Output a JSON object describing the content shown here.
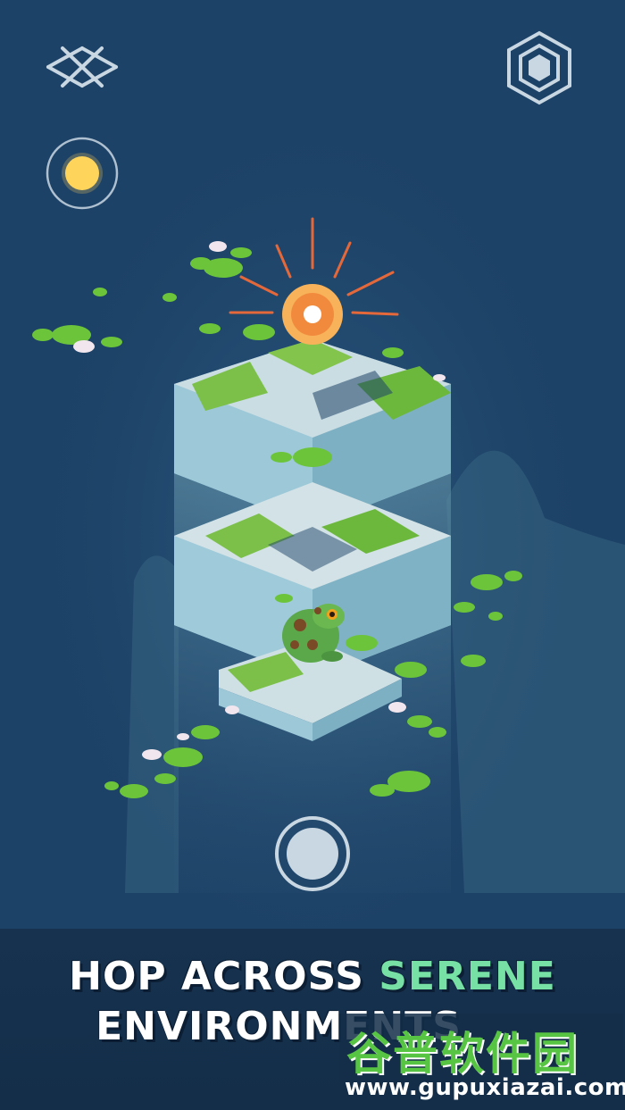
{
  "hud": {
    "menu_icon": "lattice-menu-icon",
    "hex_icon": "hexagon-icon",
    "sun_icon": "sun-toggle-icon",
    "jump_icon": "jump-button-icon"
  },
  "caption": {
    "line1_prefix": "HOP ACROSS ",
    "line1_accent": "SERENE",
    "line2": "ENVIRONMENTS"
  },
  "watermark": {
    "cn": "谷普软件园",
    "url": "www.gupuxiazai.com"
  },
  "colors": {
    "background": "#1d4267",
    "accent": "#77e0a4",
    "lilypad": "#6cc43a",
    "stone": "#bcd6e0"
  }
}
